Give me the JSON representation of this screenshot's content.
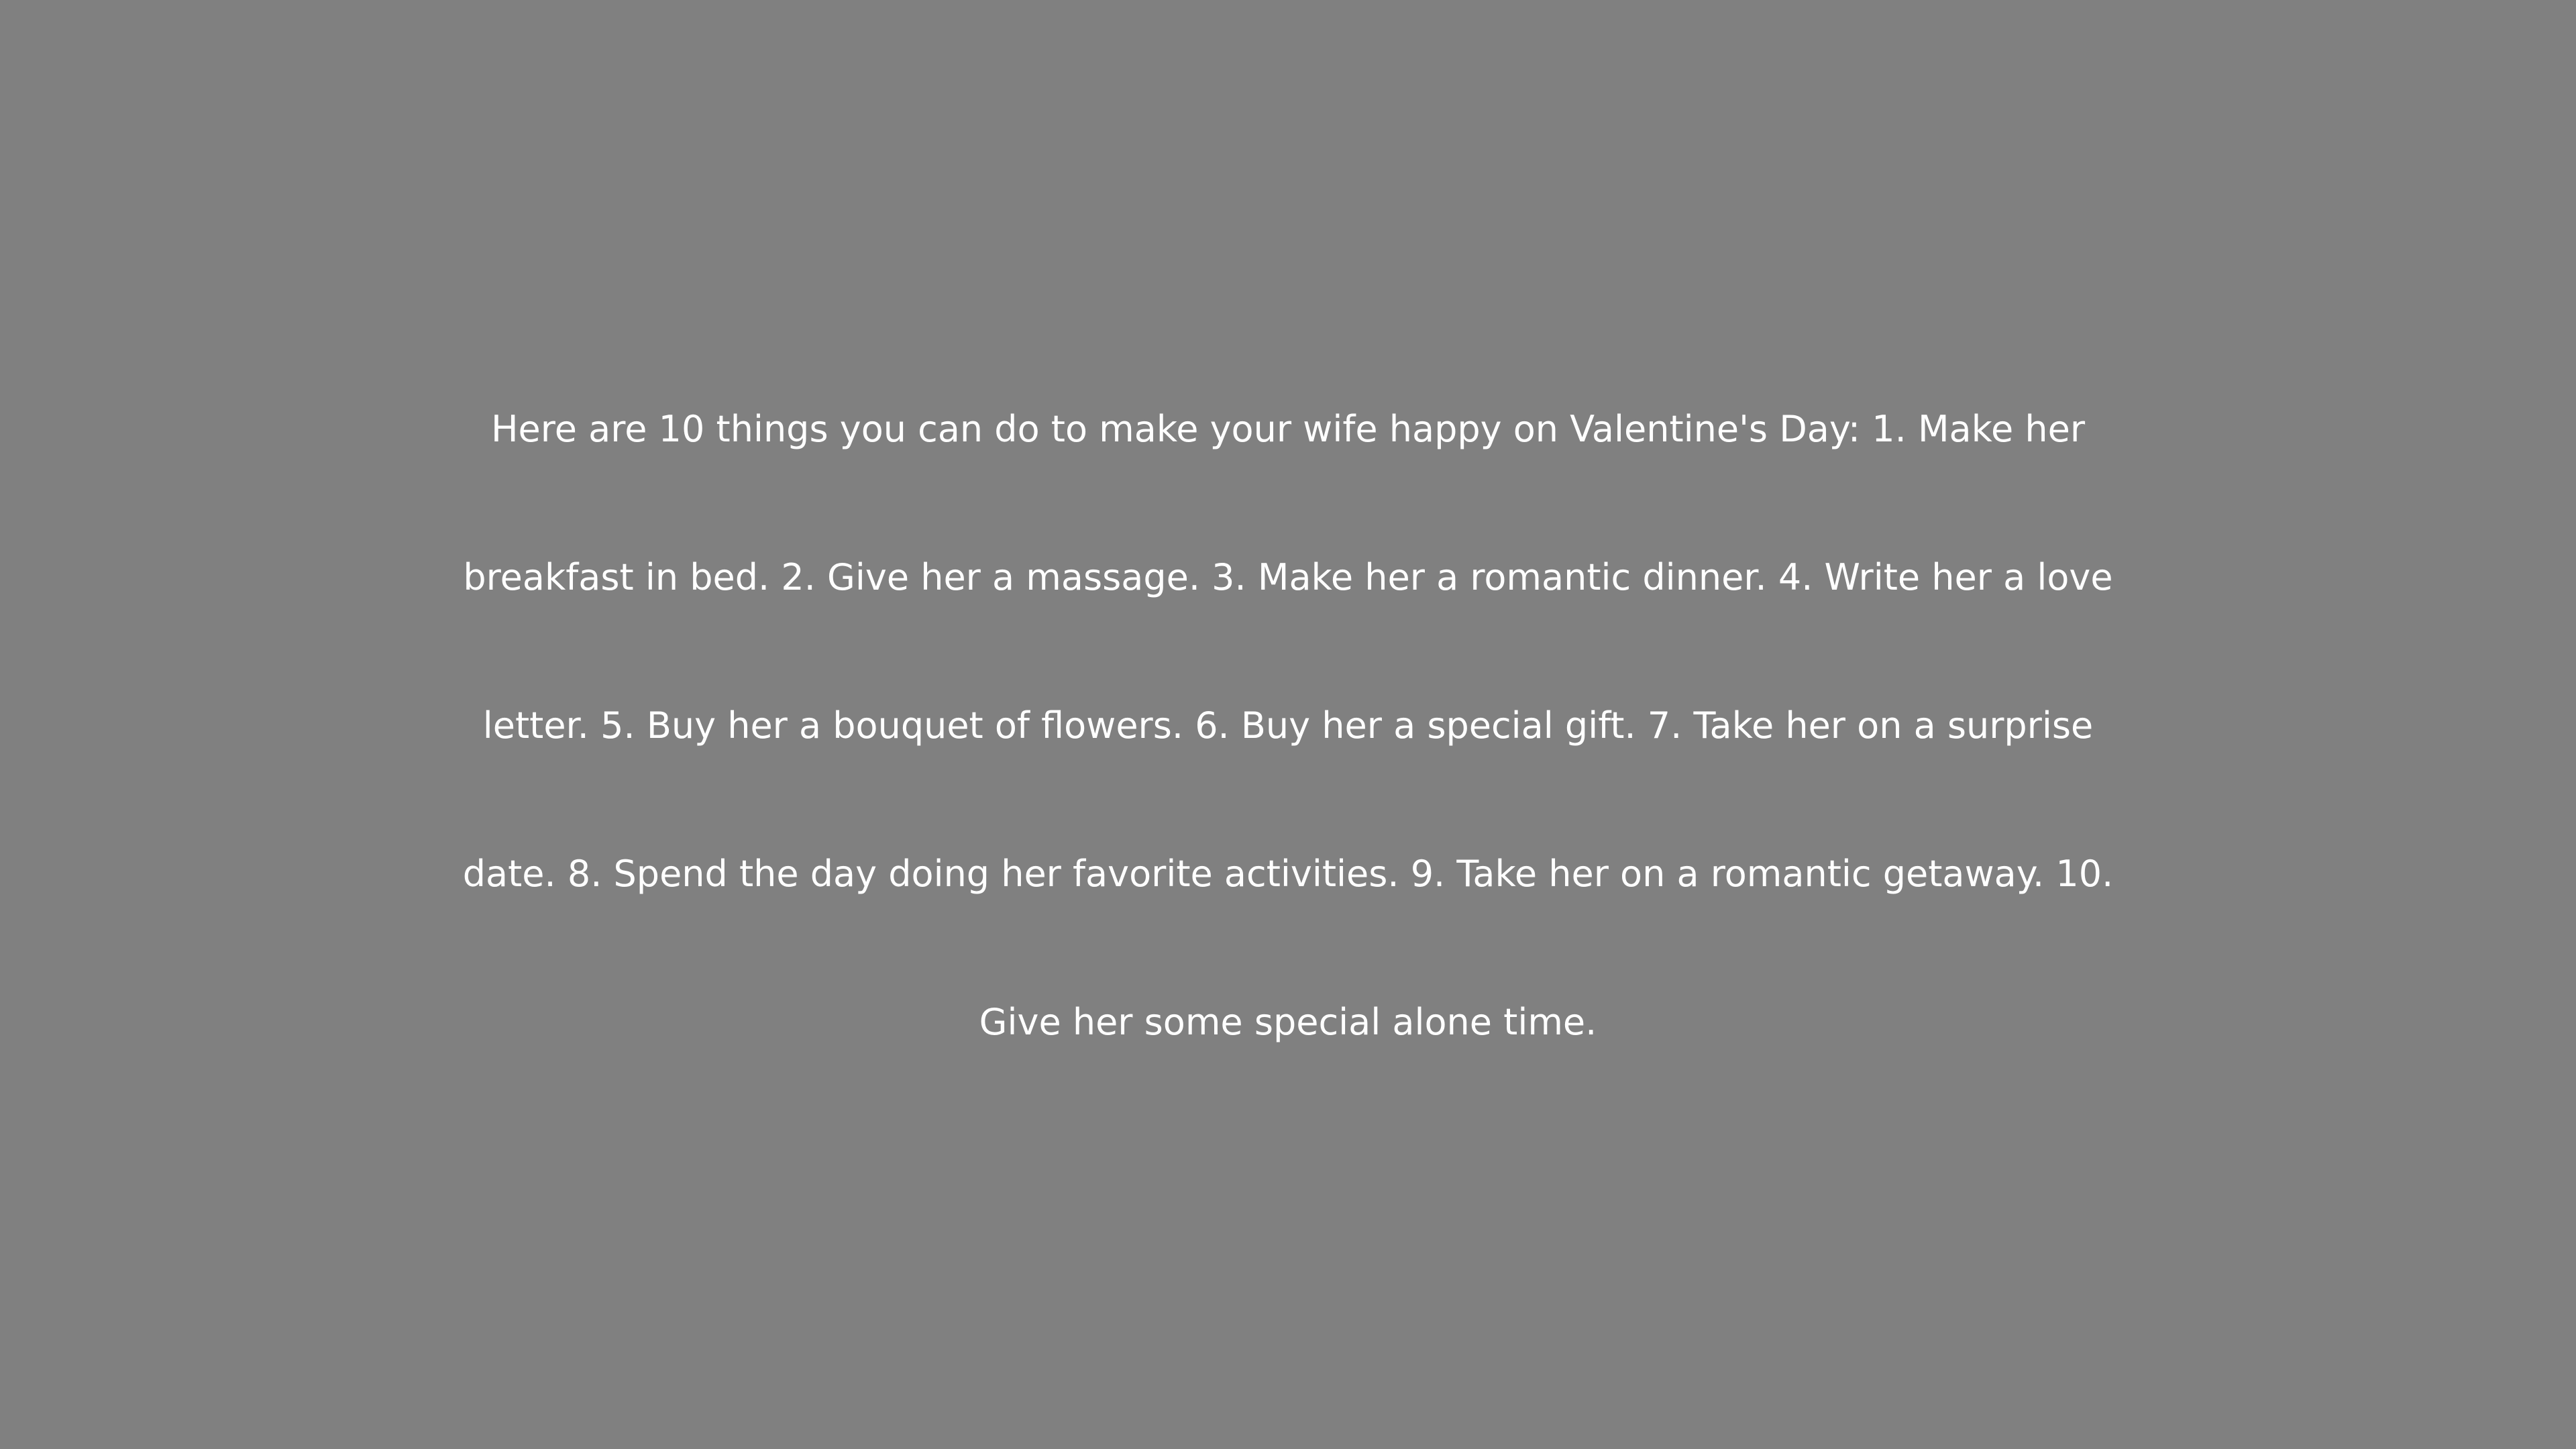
{
  "message": {
    "lines": [
      "Here are 10 things you can do to make your wife happy on Valentine's Day: 1. Make her",
      "breakfast in bed. 2. Give her a massage. 3. Make her a romantic dinner. 4. Write her a love",
      "letter. 5. Buy her a bouquet of flowers. 6. Buy her a special gift. 7. Take her on a surprise",
      "date. 8. Spend the day doing her favorite activities. 9. Take her on a romantic getaway. 10.",
      "Give her some special alone time."
    ]
  },
  "colors": {
    "background": "#808080",
    "text": "#ffffff"
  }
}
